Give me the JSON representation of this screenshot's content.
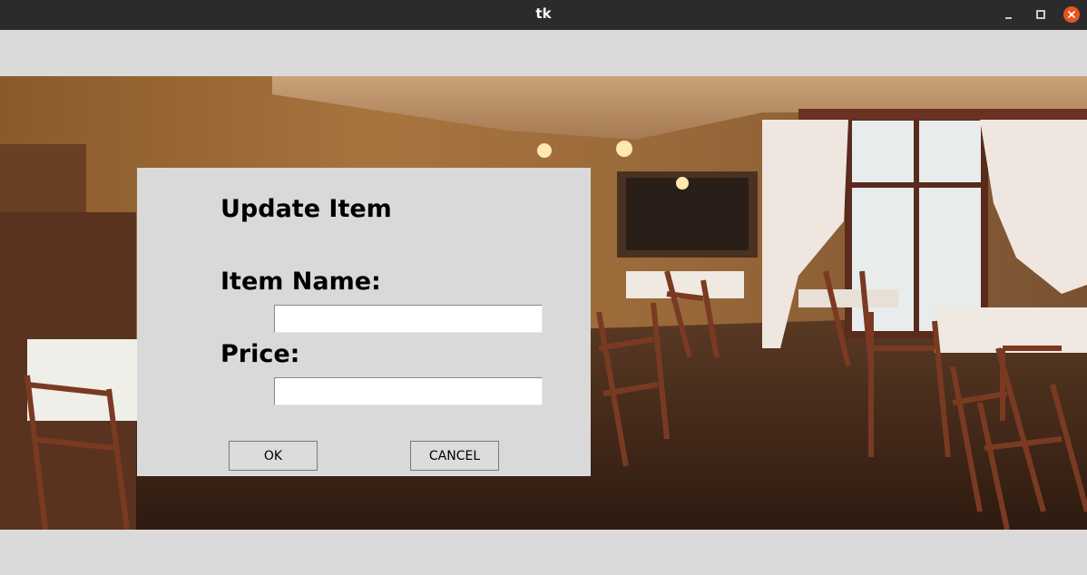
{
  "window": {
    "title": "tk",
    "controls": {
      "minimize": "minimize-icon",
      "maximize": "maximize-icon",
      "close": "close-icon"
    },
    "close_color": "#e95420"
  },
  "background": {
    "image": "restaurant-interior-photo"
  },
  "dialog": {
    "heading": "Update Item",
    "item_name_label": "Item Name:",
    "item_name_value": "",
    "price_label": "Price:",
    "price_value": "",
    "ok_label": "OK",
    "cancel_label": "CANCEL"
  }
}
